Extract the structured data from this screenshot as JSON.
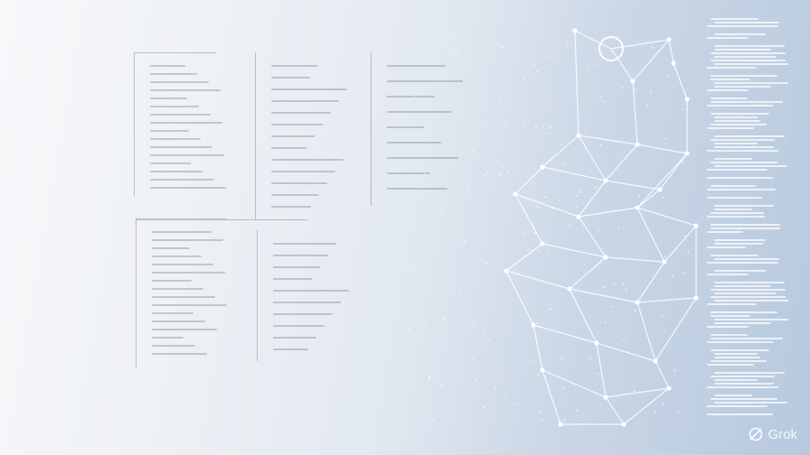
{
  "watermark": {
    "brand": "Grok",
    "icon": "grok-logo-icon",
    "color": "#ffffff"
  },
  "colors": {
    "background_left": "#f7f8fa",
    "background_right": "#b8c9de",
    "network_lines": "#ffffff",
    "doc_lines": "#7a8291"
  }
}
